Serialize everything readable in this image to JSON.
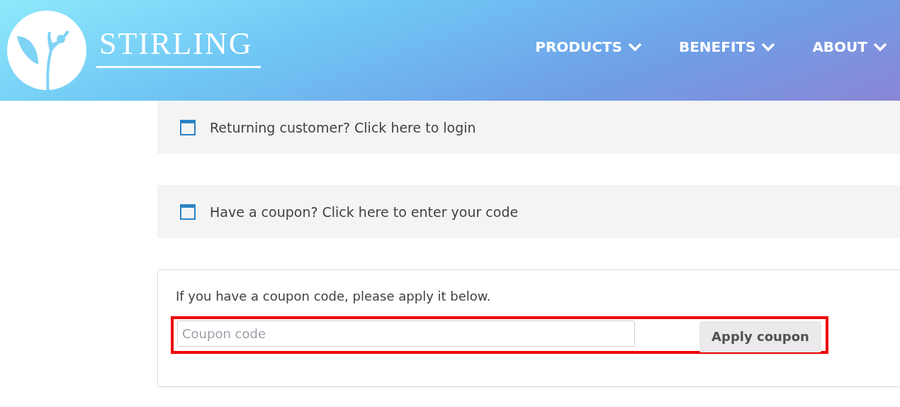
{
  "header": {
    "logo_text": "STIRLING",
    "nav": [
      {
        "label": "PRODUCTS",
        "has_dropdown": true
      },
      {
        "label": "BENEFITS",
        "has_dropdown": true
      },
      {
        "label": "ABOUT",
        "has_dropdown": true
      }
    ]
  },
  "notices": [
    {
      "text": "Returning customer? Click here to login"
    },
    {
      "text": "Have a coupon? Click here to enter your code"
    }
  ],
  "coupon_form": {
    "instruction": "If you have a coupon code, please apply it below.",
    "field": {
      "placeholder": "Coupon code"
    },
    "button": "Apply coupon",
    "highlighted": true
  }
}
